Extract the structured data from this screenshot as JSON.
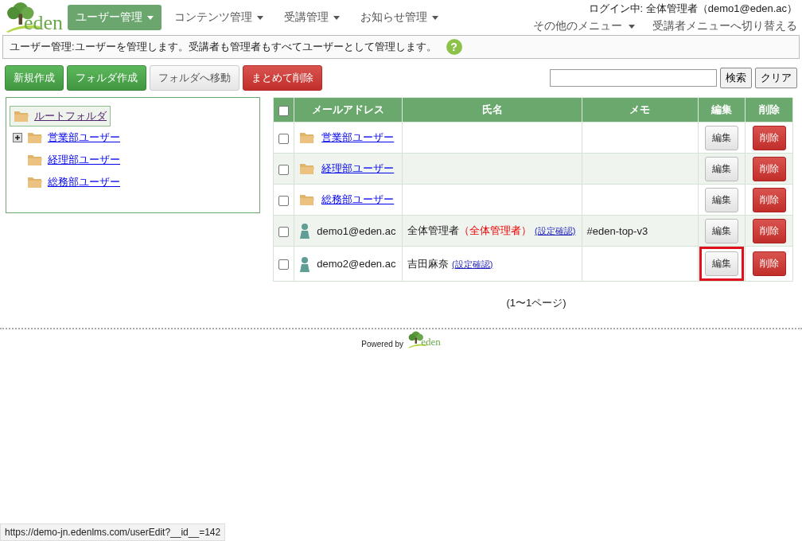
{
  "logo": {
    "text": "eden"
  },
  "nav": [
    {
      "label": "ユーザー管理",
      "selected": true
    },
    {
      "label": "コンテンツ管理",
      "selected": false
    },
    {
      "label": "受講管理",
      "selected": false
    },
    {
      "label": "お知らせ管理",
      "selected": false
    }
  ],
  "login": {
    "label": "ログイン中:",
    "user": "全体管理者（demo1@eden.ac）"
  },
  "sub_menu": [
    {
      "label": "その他のメニュー",
      "dropdown": true
    },
    {
      "label": "受講者メニューへ切り替える",
      "dropdown": false
    }
  ],
  "info_bar": {
    "text": "ユーザー管理:ユーザーを管理します。受講者も管理者もすべてユーザーとして管理します。",
    "help": "?"
  },
  "toolbar": [
    {
      "label": "新規作成",
      "kind": "green"
    },
    {
      "label": "フォルダ作成",
      "kind": "green"
    },
    {
      "label": "フォルダへ移動",
      "kind": "plain"
    },
    {
      "label": "まとめて削除",
      "kind": "red"
    }
  ],
  "search": {
    "button": "検索",
    "clear": "クリア"
  },
  "tree": {
    "root": {
      "label": "ルートフォルダ",
      "selected": true
    },
    "items": [
      {
        "label": "営業部ユーザー",
        "expandable": true
      },
      {
        "label": "経理部ユーザー",
        "expandable": false
      },
      {
        "label": "総務部ユーザー",
        "expandable": false
      }
    ]
  },
  "table": {
    "select_all": false,
    "columns": [
      "メールアドレス",
      "氏名",
      "メモ",
      "編集",
      "削除"
    ],
    "rows": [
      {
        "kind": "folder",
        "checked": false,
        "email": "営業部ユーザー",
        "edit": "編集",
        "delete": "削除",
        "edit_highlighted": false
      },
      {
        "kind": "folder",
        "checked": false,
        "email": "経理部ユーザー",
        "edit": "編集",
        "delete": "削除",
        "edit_highlighted": false
      },
      {
        "kind": "folder",
        "checked": false,
        "email": "総務部ユーザー",
        "edit": "編集",
        "delete": "削除",
        "edit_highlighted": false
      },
      {
        "kind": "user",
        "checked": false,
        "email": "demo1@eden.ac",
        "name": "全体管理者",
        "role": "（全体管理者）",
        "settings": "(設定確認)",
        "memo": "#eden-top-v3",
        "edit": "編集",
        "delete": "削除",
        "edit_highlighted": false
      },
      {
        "kind": "user",
        "checked": false,
        "email": "demo2@eden.ac",
        "name": "吉田麻奈",
        "settings": "(設定確認)",
        "edit": "編集",
        "delete": "削除",
        "edit_highlighted": true
      }
    ]
  },
  "pager": "(1〜1ページ)",
  "footer": {
    "powered": "Powered by",
    "logo": "eden"
  },
  "status_bar": "https://demo-jn.edenlms.com/userEdit?__id__=142"
}
